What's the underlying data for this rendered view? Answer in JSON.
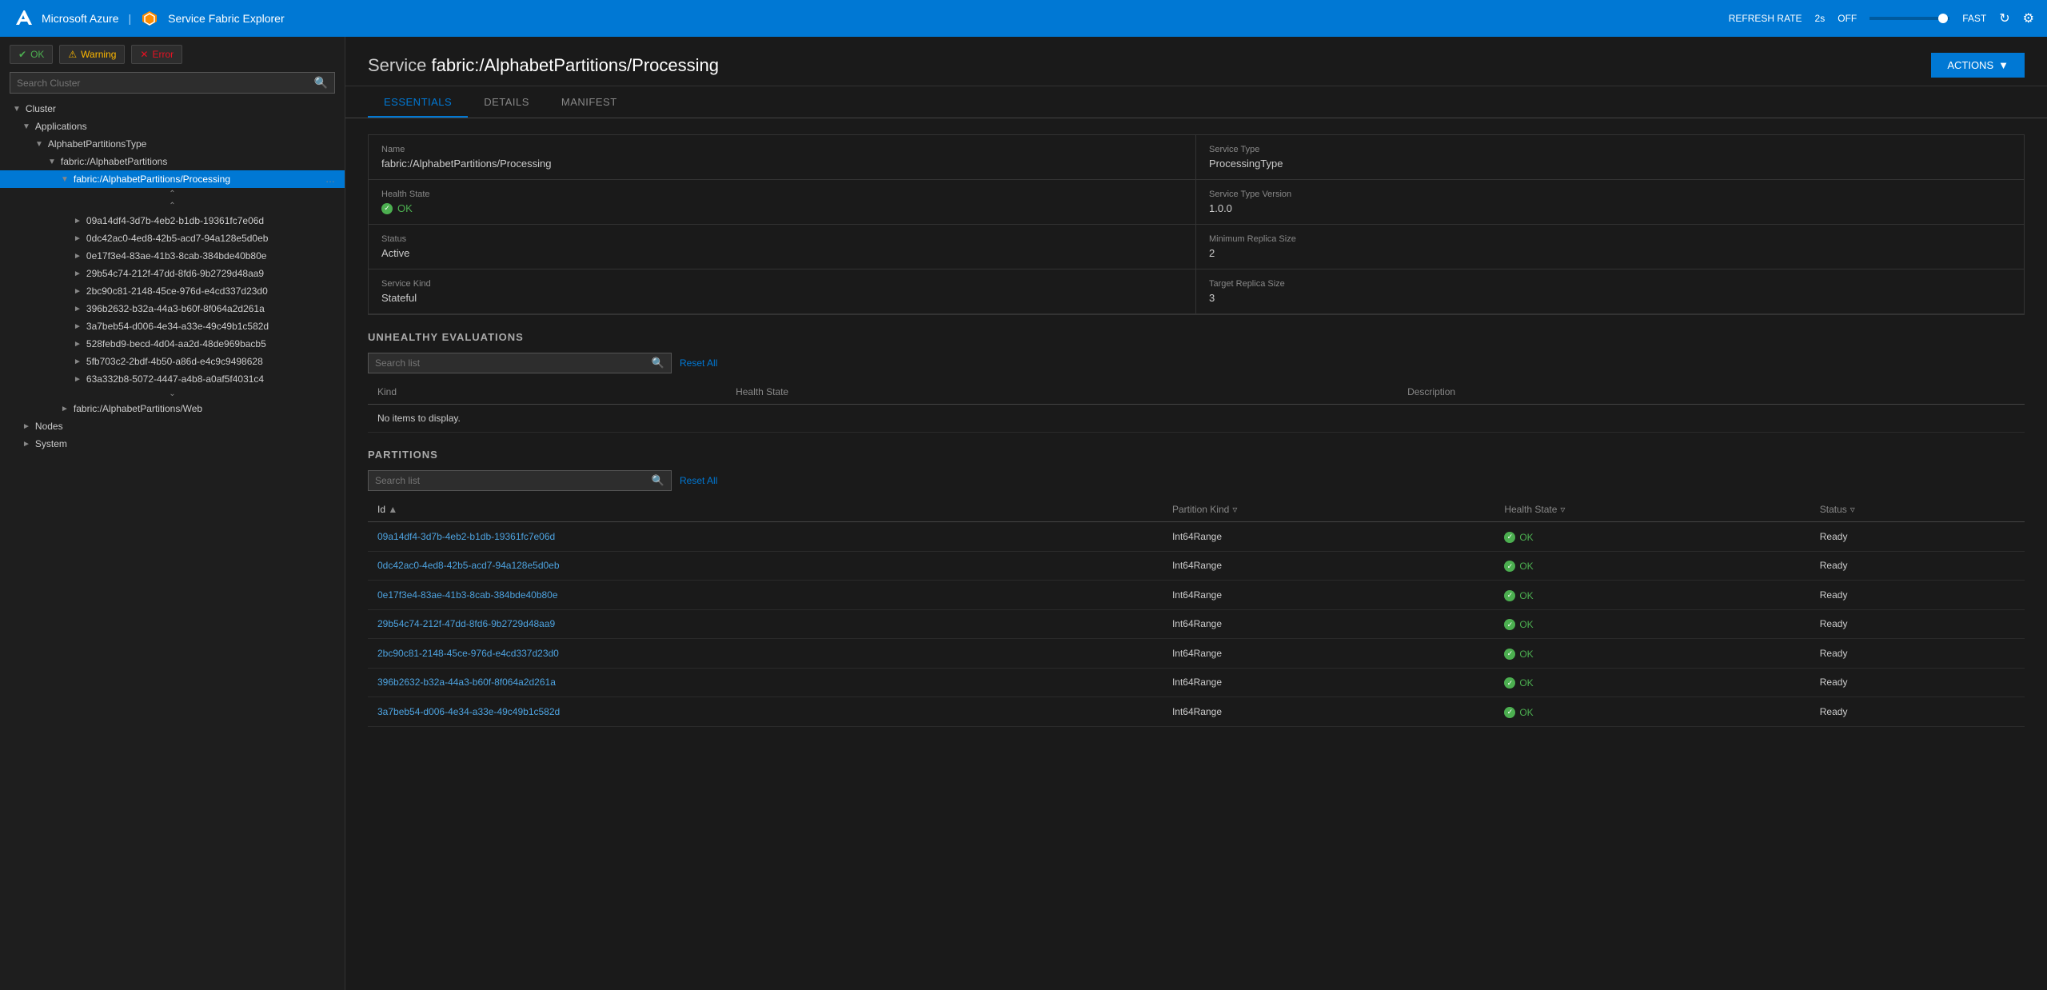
{
  "topnav": {
    "brand": "Microsoft Azure",
    "app": "Service Fabric Explorer",
    "refresh_label": "REFRESH RATE",
    "refresh_rate": "2s",
    "off_label": "OFF",
    "fast_label": "FAST"
  },
  "sidebar": {
    "search_placeholder": "Search Cluster",
    "ok_label": "OK",
    "warning_label": "Warning",
    "error_label": "Error",
    "cluster_label": "Cluster",
    "applications_label": "Applications",
    "alphabet_type_label": "AlphabetPartitionsType",
    "alphabet_app_label": "fabric:/AlphabetPartitions",
    "processing_label": "fabric:/AlphabetPartitions/Processing",
    "web_label": "fabric:/AlphabetPartitions/Web",
    "nodes_label": "Nodes",
    "system_label": "System",
    "partitions": [
      "09a14df4-3d7b-4eb2-b1db-19361fc7e06d",
      "0dc42ac0-4ed8-42b5-acd7-94a128e5d0eb",
      "0e17f3e4-83ae-41b3-8cab-384bde40b80e",
      "29b54c74-212f-47dd-8fd6-9b2729d48aa9",
      "2bc90c81-2148-45ce-976d-e4cd337d23d0",
      "396b2632-b32a-44a3-b60f-8f064a2d261a",
      "3a7beb54-d006-4e34-a33e-49c49b1c582d",
      "528febd9-becd-4d04-aa2d-48de969bacb5",
      "5fb703c2-2bdf-4b50-a86d-e4c9c9498628",
      "63a332b8-5072-4447-a4b8-a0af5f4031c4"
    ]
  },
  "content": {
    "service_prefix": "Service",
    "service_name": "fabric:/AlphabetPartitions/Processing",
    "actions_label": "ACTIONS",
    "tabs": [
      "ESSENTIALS",
      "DETAILS",
      "MANIFEST"
    ],
    "active_tab": "ESSENTIALS",
    "essentials": {
      "name_label": "Name",
      "name_value": "fabric:/AlphabetPartitions/Processing",
      "service_type_label": "Service Type",
      "service_type_value": "ProcessingType",
      "health_state_label": "Health State",
      "health_state_value": "OK",
      "service_type_version_label": "Service Type Version",
      "service_type_version_value": "1.0.0",
      "status_label": "Status",
      "status_value": "Active",
      "min_replica_label": "Minimum Replica Size",
      "min_replica_value": "2",
      "service_kind_label": "Service Kind",
      "service_kind_value": "Stateful",
      "target_replica_label": "Target Replica Size",
      "target_replica_value": "3"
    },
    "unhealthy_section": {
      "title": "UNHEALTHY EVALUATIONS",
      "search_placeholder": "Search list",
      "reset_label": "Reset All",
      "columns": [
        "Kind",
        "Health State",
        "Description"
      ],
      "no_items": "No items to display."
    },
    "partitions_section": {
      "title": "PARTITIONS",
      "search_placeholder": "Search list",
      "reset_label": "Reset All",
      "columns": [
        "Id",
        "Partition Kind",
        "Health State",
        "Status"
      ],
      "rows": [
        {
          "id": "09a14df4-3d7b-4eb2-b1db-19361fc7e06d",
          "kind": "Int64Range",
          "health": "OK",
          "status": "Ready"
        },
        {
          "id": "0dc42ac0-4ed8-42b5-acd7-94a128e5d0eb",
          "kind": "Int64Range",
          "health": "OK",
          "status": "Ready"
        },
        {
          "id": "0e17f3e4-83ae-41b3-8cab-384bde40b80e",
          "kind": "Int64Range",
          "health": "OK",
          "status": "Ready"
        },
        {
          "id": "29b54c74-212f-47dd-8fd6-9b2729d48aa9",
          "kind": "Int64Range",
          "health": "OK",
          "status": "Ready"
        },
        {
          "id": "2bc90c81-2148-45ce-976d-e4cd337d23d0",
          "kind": "Int64Range",
          "health": "OK",
          "status": "Ready"
        },
        {
          "id": "396b2632-b32a-44a3-b60f-8f064a2d261a",
          "kind": "Int64Range",
          "health": "OK",
          "status": "Ready"
        },
        {
          "id": "3a7beb54-d006-4e34-a33e-49c49b1c582d",
          "kind": "Int64Range",
          "health": "OK",
          "status": "Ready"
        }
      ]
    }
  }
}
